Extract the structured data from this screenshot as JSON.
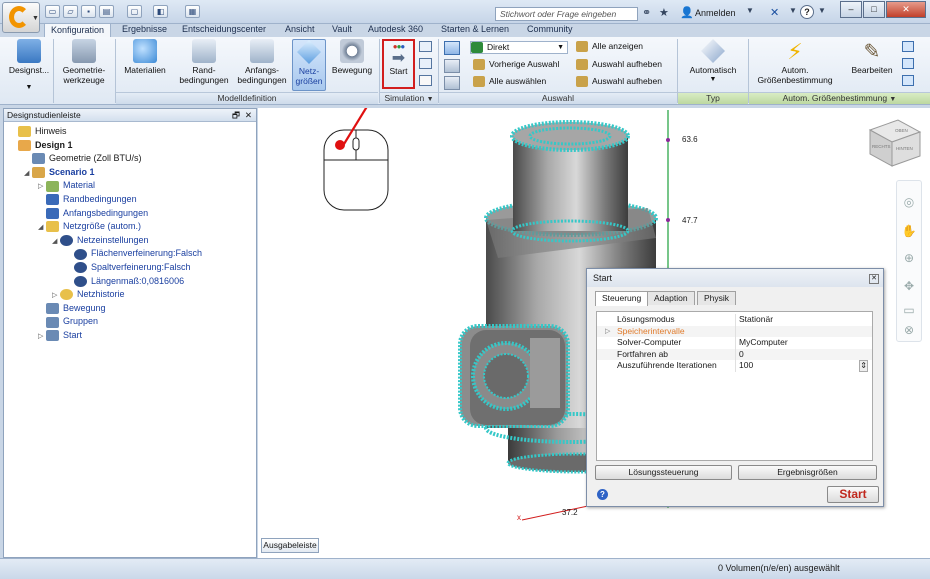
{
  "titlebar": {
    "search_placeholder": "Stichwort oder Frage eingeben",
    "login_label": "Anmelden",
    "help_label": "?",
    "minimize": "–",
    "maximize": "□",
    "close": "✕"
  },
  "tabs": [
    "Konfiguration",
    "Ergebnisse",
    "Entscheidungscenter",
    "Ansicht",
    "Vault",
    "Autodesk 360",
    "Starten & Lernen",
    "Community"
  ],
  "ribbon": {
    "design_label": "Designst...",
    "geom_label_1": "Geometrie-",
    "geom_label_2": "werkzeuge",
    "materialien": "Materialien",
    "rand_1": "Rand-",
    "rand_2": "bedingungen",
    "anfang_1": "Anfangs-",
    "anfang_2": "bedingungen",
    "netz_1": "Netz-",
    "netz_2": "größen",
    "bewegung": "Bewegung",
    "start": "Start",
    "direkt": "Direkt",
    "vorherige_auswahl": "Vorherige Auswahl",
    "alle_auswaehlen": "Alle auswählen",
    "alle_anzeigen": "Alle anzeigen",
    "auswahl_aufheben_1": "Auswahl aufheben",
    "auswahl_aufheben_2": "Auswahl aufheben",
    "automatisch": "Automatisch",
    "autom_1": "Autom.",
    "autom_2": "Größenbestimmung",
    "bearbeiten": "Bearbeiten",
    "grp_modell": "Modelldefinition",
    "grp_simulation": "Simulation",
    "grp_auswahl": "Auswahl",
    "grp_typ": "Typ",
    "grp_autom": "Autom. Größenbestimmung"
  },
  "leftpanel": {
    "title": "Designstudienleiste",
    "tree": [
      {
        "label": "Hinweis",
        "indent": 0,
        "style": ""
      },
      {
        "label": "Design 1",
        "indent": 0,
        "style": "bold"
      },
      {
        "label": "Geometrie (Zoll BTU/s)",
        "indent": 1,
        "style": ""
      },
      {
        "label": "Scenario 1",
        "indent": 1,
        "style": "bold blue"
      },
      {
        "label": "Material",
        "indent": 2,
        "style": "blue"
      },
      {
        "label": "Randbedingungen",
        "indent": 2,
        "style": "blue"
      },
      {
        "label": "Anfangsbedingungen",
        "indent": 2,
        "style": "blue"
      },
      {
        "label": "Netzgröße (autom.)",
        "indent": 2,
        "style": "blue"
      },
      {
        "label": "Netzeinstellungen",
        "indent": 3,
        "style": "blue"
      },
      {
        "label": "Flächenverfeinerung:Falsch",
        "indent": 4,
        "style": "blue"
      },
      {
        "label": "Spaltverfeinerung:Falsch",
        "indent": 4,
        "style": "blue"
      },
      {
        "label": "Längenmaß:0,0816006",
        "indent": 4,
        "style": "blue"
      },
      {
        "label": "Netzhistorie",
        "indent": 3,
        "style": "blue"
      },
      {
        "label": "Bewegung",
        "indent": 2,
        "style": "blue"
      },
      {
        "label": "Gruppen",
        "indent": 2,
        "style": "blue"
      },
      {
        "label": "Start",
        "indent": 2,
        "style": "blue"
      }
    ]
  },
  "viewport": {
    "axis_top": "63.6",
    "axis_mid": "47.7",
    "axis_bottom": "37.2",
    "axis_x": "x",
    "viewcube_left": "RECHTS",
    "viewcube_right": "HINTEN",
    "viewcube_top": "OBEN"
  },
  "dialog": {
    "title": "Start",
    "tabs": [
      "Steuerung",
      "Adaption",
      "Physik"
    ],
    "rows": [
      {
        "key": "Lösungsmodus",
        "value": "Stationär"
      },
      {
        "key": "Speicherintervalle",
        "value": ""
      },
      {
        "key": "Solver-Computer",
        "value": "MyComputer"
      },
      {
        "key": "Fortfahren ab",
        "value": "0"
      },
      {
        "key": "Auszuführende Iterationen",
        "value": "100"
      }
    ],
    "btn_loesung": "Lösungssteuerung",
    "btn_ergebnis": "Ergebnisgrößen",
    "btn_start": "Start",
    "help": "?"
  },
  "statusbar": {
    "ausgabe": "Ausgabeleiste",
    "status": "0 Volumen(n/e/en) ausgewählt"
  }
}
